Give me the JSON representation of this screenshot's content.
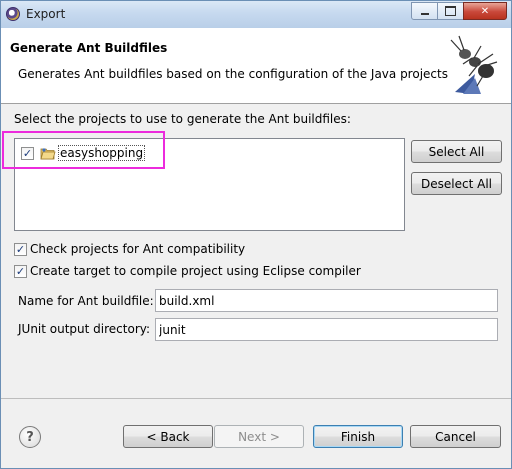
{
  "window": {
    "title": "Export"
  },
  "header": {
    "title": "Generate Ant Buildfiles",
    "description": "Generates Ant buildfiles based on the configuration of the Java projects"
  },
  "projects": {
    "label": "Select the projects to use to generate the Ant buildfiles:",
    "items": [
      {
        "label": "easyshopping",
        "checked": true
      }
    ],
    "select_all": "Select All",
    "deselect_all": "Deselect All"
  },
  "options": {
    "check_compat": {
      "label": "Check projects for Ant compatibility",
      "checked": true
    },
    "create_target": {
      "label": "Create target to compile project using Eclipse compiler",
      "checked": true
    }
  },
  "fields": {
    "buildfile": {
      "label": "Name for Ant buildfile:",
      "value": "build.xml"
    },
    "junit": {
      "label": "JUnit output directory:",
      "value": "junit"
    }
  },
  "buttons": {
    "back": "< Back",
    "next": "Next >",
    "finish": "Finish",
    "cancel": "Cancel"
  },
  "colors": {
    "highlight": "#ec2bdd"
  },
  "icons": {
    "app": "eclipse-icon",
    "banner": "ant-icon",
    "help": "help-icon",
    "project": "project-folder-icon"
  }
}
